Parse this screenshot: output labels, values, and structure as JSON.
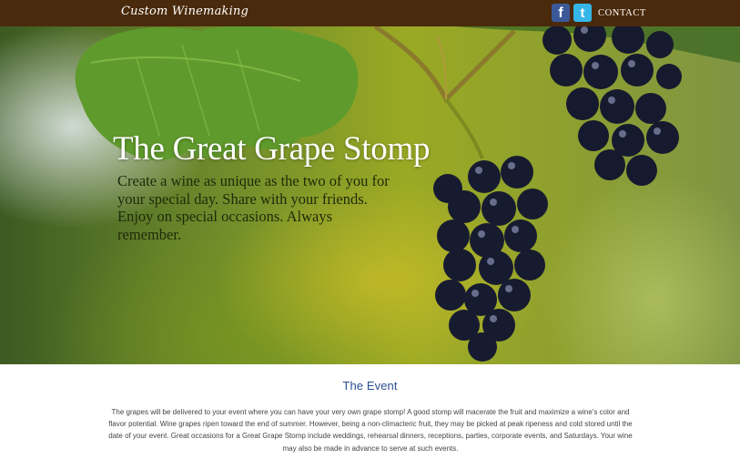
{
  "header": {
    "logo_text": "Custom Winemaking",
    "facebook_icon": "facebook-icon",
    "facebook_glyph": "f",
    "twitter_icon": "twitter-icon",
    "twitter_glyph": "t",
    "contact_label": "CONTACT"
  },
  "hero": {
    "title": "The Great Grape Stomp",
    "subtitle": "Create a wine as unique as the two of you for your special day. Share with your friends. Enjoy on special occasions. Always remember."
  },
  "event": {
    "heading": "The Event",
    "body": "The grapes will be delivered to your event where you can have your very own grape stomp! A good stomp will macerate the fruit and maximize a wine's color and flavor potential. Wine grapes ripen toward the end of summer. However, being a non-climacteric fruit, they may be picked at peak ripeness and cold stored until the date of your event. Great occasions for a Great Grape Stomp include weddings, rehearsal dinners, receptions, parties, corporate events, and Saturdays. Your wine may also be made in advance to serve at such events."
  },
  "colors": {
    "topbar": "#4a2a0c",
    "heading_blue": "#2a4d93",
    "facebook": "#3b5998",
    "twitter": "#35b6e8"
  }
}
